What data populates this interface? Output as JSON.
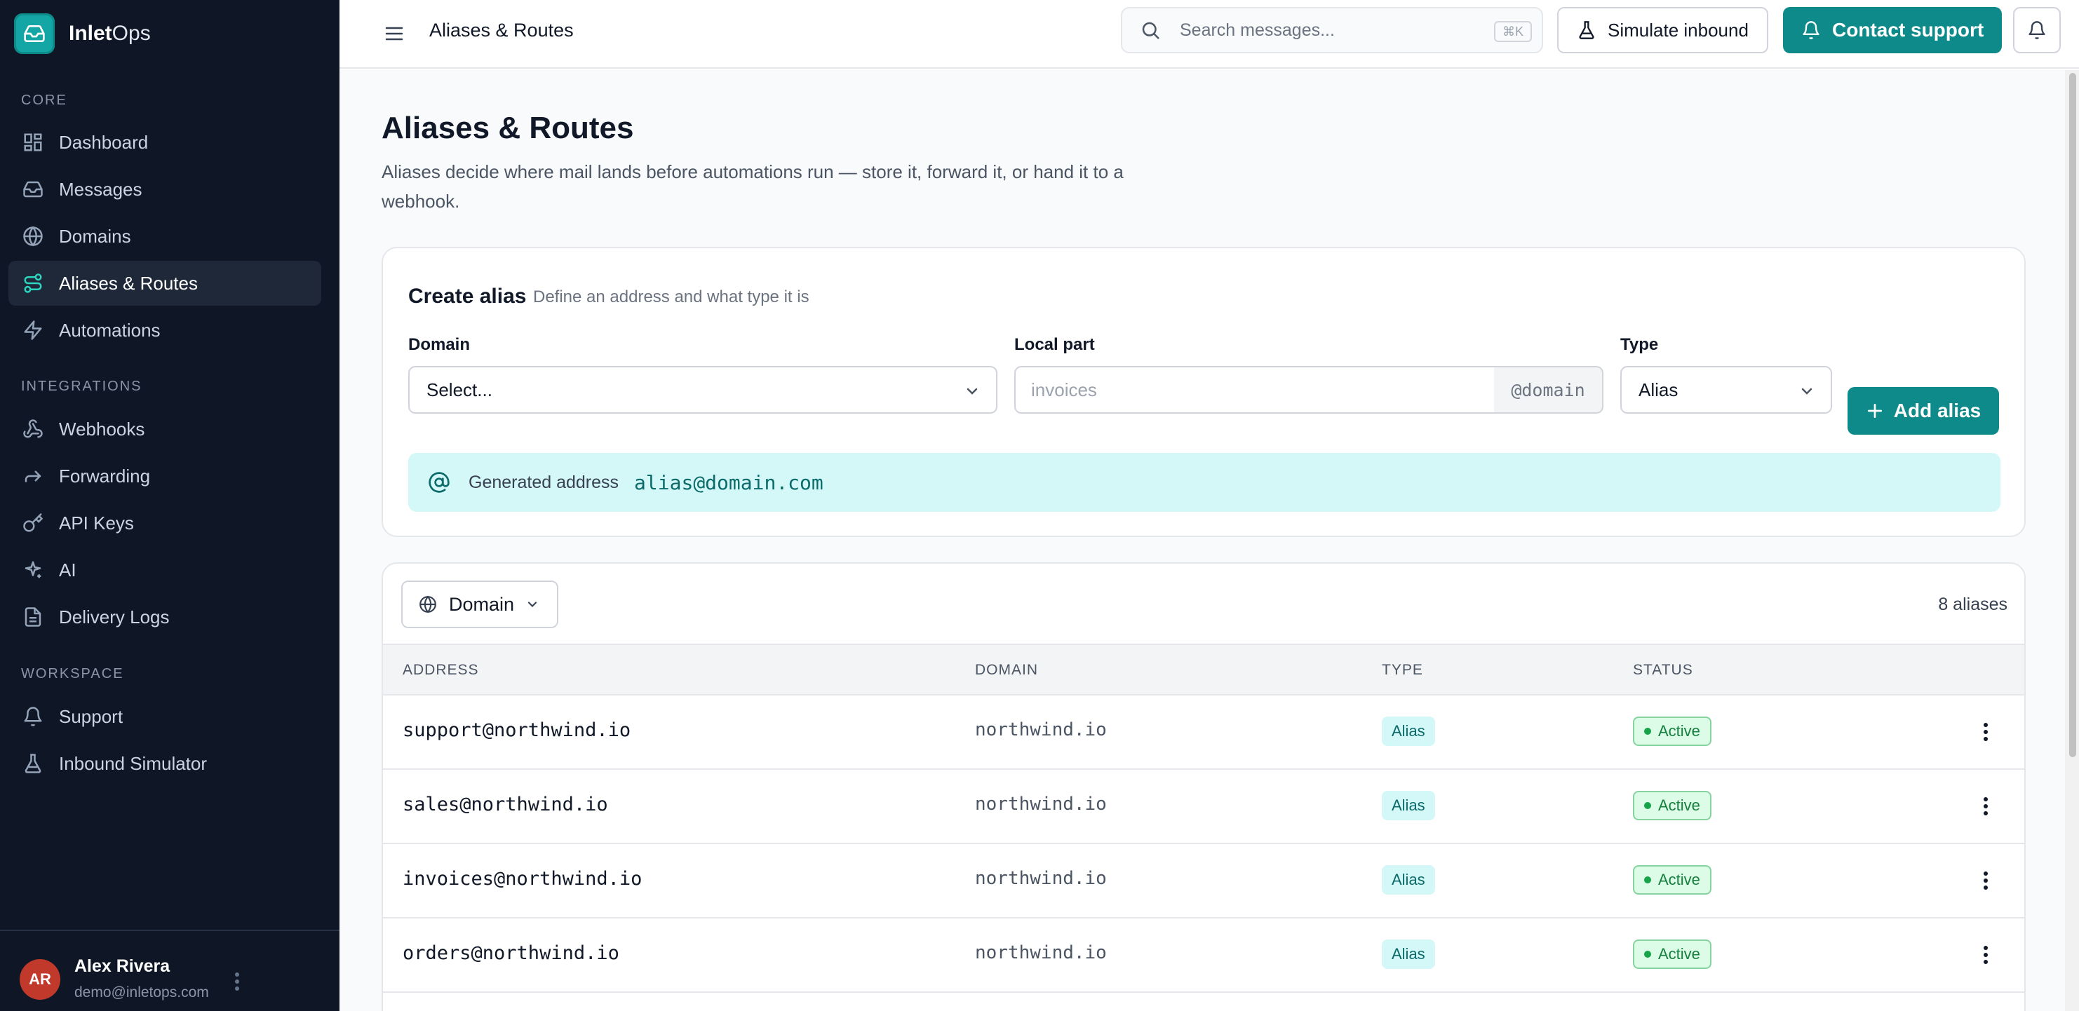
{
  "app": {
    "name_bold": "Inlet",
    "name_light": "Ops",
    "logo_icon": "inbox-icon"
  },
  "sidebar": {
    "sections": [
      {
        "label": "CORE",
        "items": [
          {
            "label": "Dashboard",
            "icon": "grid-icon"
          },
          {
            "label": "Messages",
            "icon": "inbox-icon"
          },
          {
            "label": "Domains",
            "icon": "globe-icon"
          },
          {
            "label": "Aliases & Routes",
            "icon": "route-icon",
            "active": true
          },
          {
            "label": "Automations",
            "icon": "bolt-icon"
          }
        ]
      },
      {
        "label": "INTEGRATIONS",
        "items": [
          {
            "label": "Webhooks",
            "icon": "webhook-icon"
          },
          {
            "label": "Forwarding",
            "icon": "forward-icon"
          },
          {
            "label": "API Keys",
            "icon": "key-icon"
          },
          {
            "label": "AI",
            "icon": "sparkles-icon"
          },
          {
            "label": "Delivery Logs",
            "icon": "document-icon"
          }
        ]
      },
      {
        "label": "WORKSPACE",
        "items": [
          {
            "label": "Support",
            "icon": "bell-icon"
          },
          {
            "label": "Inbound Simulator",
            "icon": "flask-icon"
          }
        ]
      }
    ],
    "user": {
      "initials": "AR",
      "name": "Alex Rivera",
      "email": "demo@inletops.com"
    }
  },
  "topbar": {
    "title": "Aliases & Routes",
    "search_placeholder": "Search messages...",
    "search_shortcut": "⌘K",
    "simulate_label": "Simulate inbound",
    "support_label": "Contact support"
  },
  "page": {
    "title": "Aliases & Routes",
    "description": "Aliases decide where mail lands before automations run — store it, forward it, or hand it to a webhook."
  },
  "create": {
    "title": "Create alias",
    "subtitle": "Define an address and what type it is",
    "domain_label": "Domain",
    "domain_value": "Select...",
    "local_label": "Local part",
    "local_placeholder": "invoices",
    "local_suffix": "@domain",
    "type_label": "Type",
    "type_value": "Alias",
    "add_label": "Add alias",
    "generated_label": "Generated address",
    "generated_value": "alias@domain.com"
  },
  "list": {
    "filter_label": "Domain",
    "count": "8 aliases",
    "columns": [
      "ADDRESS",
      "DOMAIN",
      "TYPE",
      "STATUS"
    ],
    "rows": [
      {
        "address": "support@northwind.io",
        "domain": "northwind.io",
        "type": "Alias",
        "status": "Active"
      },
      {
        "address": "sales@northwind.io",
        "domain": "northwind.io",
        "type": "Alias",
        "status": "Active"
      },
      {
        "address": "invoices@northwind.io",
        "domain": "northwind.io",
        "type": "Alias",
        "status": "Active"
      },
      {
        "address": "orders@northwind.io",
        "domain": "northwind.io",
        "type": "Alias",
        "status": "Active"
      }
    ]
  },
  "colors": {
    "accent": "#0e8a8a",
    "sidebar_bg": "#0f1726",
    "status_active": "#15803d"
  }
}
